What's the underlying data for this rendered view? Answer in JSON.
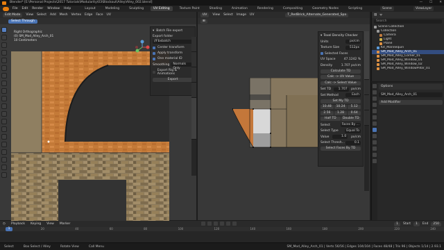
{
  "window": {
    "title": "Blender* [E:\\Personal Projects\\2017 Tutorials\\Modularity\\03\\Blockout\\Alley\\Alley_002.blend]",
    "buttons": [
      "—",
      "☐",
      "✕"
    ]
  },
  "menu": {
    "items": [
      "File",
      "Edit",
      "Render",
      "Window",
      "Help"
    ],
    "workspaces": [
      "Layout",
      "Modeling",
      "Sculpting",
      "UV Editing",
      "Texture Paint",
      "Shading",
      "Animation",
      "Rendering",
      "Compositing",
      "Geometry Nodes",
      "Scripting"
    ],
    "active_workspace": "UV Editing",
    "scene_label": "Scene",
    "view_layer_label": "ViewLayer"
  },
  "viewport": {
    "mode": "Edit Mode",
    "header_items": [
      "View",
      "Select",
      "Add",
      "Mesh",
      "Vertex",
      "Edge",
      "Face",
      "UV"
    ],
    "tool_label": "Select Through",
    "overlay_lines": [
      "Right Orthographic",
      "(0) SM_Mod_Alley_Arch_01",
      "10 Centimeters"
    ],
    "npanel": {
      "batch_label": "Batch File export",
      "export_folder_label": "Export folder",
      "export_folder_value": "//Fbxbatch",
      "options": [
        "Center transform",
        "Apply transform",
        "One material ID"
      ],
      "smoothing_label": "Smoothing",
      "smoothing_value": "Normals Only",
      "anim_label": "Export Rig & Animations",
      "export_button": "Export"
    },
    "tabs": [
      "Item",
      "Tool",
      "View",
      "Edit",
      "Fbx Batch Export"
    ]
  },
  "uv_editor": {
    "header_items": [
      "View",
      "Select",
      "Image",
      "UV"
    ],
    "image_name": "T_RedBrick_Alternate_Generated_Spa",
    "panel": {
      "title": "Texel Density Checker",
      "units_label": "Units",
      "units_value": "px/cm",
      "texture_size_label": "Texture Size",
      "texture_size_value": "512px",
      "selected_faces_label": "Selected Faces",
      "uv_space_label": "UV Space",
      "uv_space_value": "47.1242 %",
      "density_label": "Density",
      "density_value": "1.707 px/cm",
      "calc_td": "Calculate TD",
      "calc_uv": "Calc -> UV Value",
      "calc_sel": "Calc -> Select Value",
      "set_td_label": "Set TD",
      "set_td_value": "1.707",
      "set_td_unit": "px/cm",
      "set_method_label": "Set Method",
      "set_method_value": "Each",
      "set_my_td": "Set My TD",
      "presets_row1": [
        "10.48",
        "10.24",
        "5.12"
      ],
      "presets_row2": [
        "2.56",
        "1.28",
        "0.64"
      ],
      "half_td": "Half TD",
      "double_td": "Double TD",
      "select_label": "Select",
      "select_value": "Faces By ...",
      "select_type_label": "Select Type",
      "select_type_value": "Equal To",
      "value_label": "Value",
      "value_value": "1.0",
      "unit_value": "px/cm",
      "threshold_label": "Select Thresh...",
      "threshold_value": "0.1",
      "select_faces_btn": "Select Faces By TD"
    },
    "tabs": [
      "Texel Density",
      "Tool",
      "View",
      "Image"
    ]
  },
  "outliner": {
    "search_placeholder": "Search",
    "items": [
      {
        "label": "Scene Collection",
        "selected": false,
        "color": "#9a9a9a"
      },
      {
        "label": "Collection",
        "selected": false,
        "color": "#9a9a9a"
      },
      {
        "label": "Camera",
        "selected": false,
        "color": "#c07a3e"
      },
      {
        "label": "Light",
        "selected": false,
        "color": "#d0b34a"
      },
      {
        "label": "Plane",
        "selected": false,
        "color": "#e09142"
      },
      {
        "label": "Kit_Mannequin",
        "selected": false,
        "color": "#5d9bd8"
      },
      {
        "label": "SM_Mod_Alley_Arch_01",
        "selected": true,
        "color": "#e09142"
      },
      {
        "label": "SM_Mod_Alley_Corner_01",
        "selected": false,
        "color": "#e09142"
      },
      {
        "label": "SM_Mod_Alley_Window_01",
        "selected": false,
        "color": "#e09142"
      },
      {
        "label": "SM_Mod_Alley_Window_02",
        "selected": false,
        "color": "#e09142"
      },
      {
        "label": "SM_Mod_Alley_WindowPillar_01",
        "selected": false,
        "color": "#e09142"
      }
    ]
  },
  "properties": {
    "header": "Options",
    "object_name": "SM_Mod_Alley_Arch_01",
    "add_modifier": "Add Modifier"
  },
  "timeline": {
    "items": [
      "Playback",
      "Keying",
      "View",
      "Marker"
    ],
    "current_frame": "1",
    "start_label": "Start",
    "start_value": "1",
    "end_label": "End",
    "end_value": "250",
    "ruler": [
      "0",
      "20",
      "40",
      "60",
      "80",
      "100",
      "120",
      "140",
      "160",
      "180",
      "200",
      "220",
      "240"
    ]
  },
  "status": {
    "left": [
      "Select",
      "Box Select / Alley",
      "Rotate View",
      "Call Menu"
    ],
    "right": "SM_Mod_Alley_Arch_01 | Verts 56/56 | Edges 104/104 | Faces 48/48 | Tris 96 | Objects 1/14 | 2.93.1"
  }
}
